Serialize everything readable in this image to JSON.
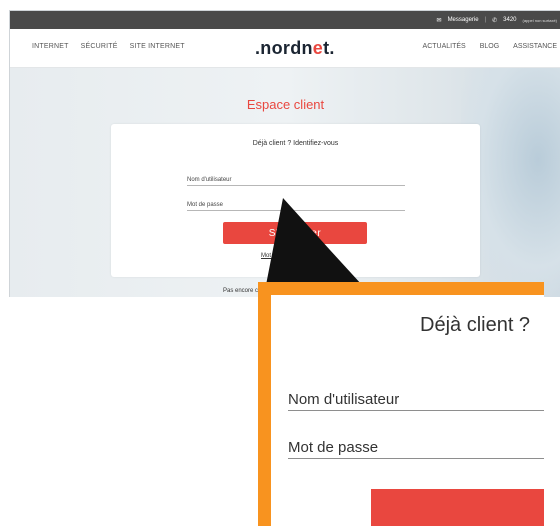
{
  "topbar": {
    "messagerie": "Messagerie",
    "separator": "|",
    "phone": "3420",
    "phone_note": "(appel non surtaxé)"
  },
  "nav": {
    "left_items": [
      "INTERNET",
      "SÉCURITÉ",
      "SITE INTERNET"
    ],
    "right_items": [
      "ACTUALITÉS",
      "BLOG",
      "ASSISTANCE"
    ]
  },
  "logo": {
    "prefix": ".nordn",
    "accent": "e",
    "suffix": "t."
  },
  "page": {
    "title": "Espace client"
  },
  "login": {
    "heading": "Déjà client ? Identifiez-vous",
    "username_placeholder": "Nom d'utilisateur",
    "password_placeholder": "Mot de passe",
    "submit_label": "S'identifier",
    "forgot_label": "Mot de passe oublié ?",
    "signup_text": "Pas encore client ?"
  },
  "zoom": {
    "heading": "Déjà client ?",
    "username_placeholder": "Nom d'utilisateur",
    "password_placeholder": "Mot de passe"
  },
  "colors": {
    "accent": "#e9473f",
    "highlight_frame": "#f8931f",
    "topbar": "#4a4a4a"
  }
}
